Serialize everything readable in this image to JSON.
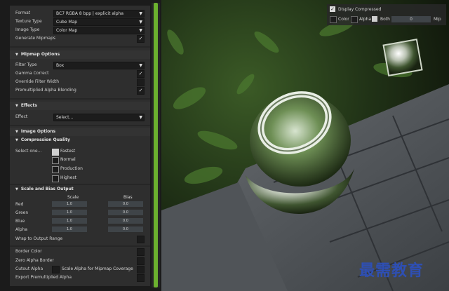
{
  "format": {
    "label": "Format",
    "value": "BC7         RGBA    8 bpp  |  explicit alpha",
    "texture_type_label": "Texture Type",
    "texture_type_value": "Cube Map",
    "image_type_label": "Image Type",
    "image_type_value": "Color Map",
    "generate_mipmaps_label": "Generate Mipmaps",
    "generate_mipmaps_checked": "✓"
  },
  "mipmap": {
    "header": "Mipmap Options",
    "filter_label": "Filter Type",
    "filter_value": "Box",
    "gamma_label": "Gamma Correct",
    "gamma_checked": "✓",
    "override_label": "Override Filter Width",
    "premult_label": "Premultiplied Alpha Blending",
    "premult_checked": "✓"
  },
  "effects": {
    "header": "Effects",
    "effect_label": "Effect",
    "effect_value": "Select..."
  },
  "image_options": {
    "header": "Image Options",
    "compression_header": "Compression Quality",
    "select_label": "Select one...",
    "options": [
      "Fastest",
      "Normal",
      "Production",
      "Highest"
    ],
    "selected": "Fastest"
  },
  "scale_bias": {
    "header": "Scale and Bias Output",
    "scale_col": "Scale",
    "bias_col": "Bias",
    "rows": [
      {
        "label": "Red",
        "scale": "1.0",
        "bias": "0.0"
      },
      {
        "label": "Green",
        "scale": "1.0",
        "bias": "0.0"
      },
      {
        "label": "Blue",
        "scale": "1.0",
        "bias": "0.0"
      },
      {
        "label": "Alpha",
        "scale": "1.0",
        "bias": "0.0"
      }
    ],
    "wrap_label": "Wrap to Output Range"
  },
  "misc": {
    "border_color": "Border Color",
    "zero_alpha": "Zero Alpha Border",
    "cutout_alpha": "Cutout Alpha",
    "scale_alpha": "Scale Alpha for Mipmap Coverage",
    "export_premult": "Export Premultiplied Alpha"
  },
  "viewer": {
    "display_compressed": "Display Compressed",
    "display_checked": "✓",
    "color": "Color",
    "alpha": "Alpha",
    "both": "Both",
    "mip_value": "0",
    "mip_label": "Mip"
  },
  "watermark": "最需教育",
  "colors": {
    "accent": "#6cb12f",
    "panel": "#2e2e2e",
    "field": "#1c1c1c"
  }
}
